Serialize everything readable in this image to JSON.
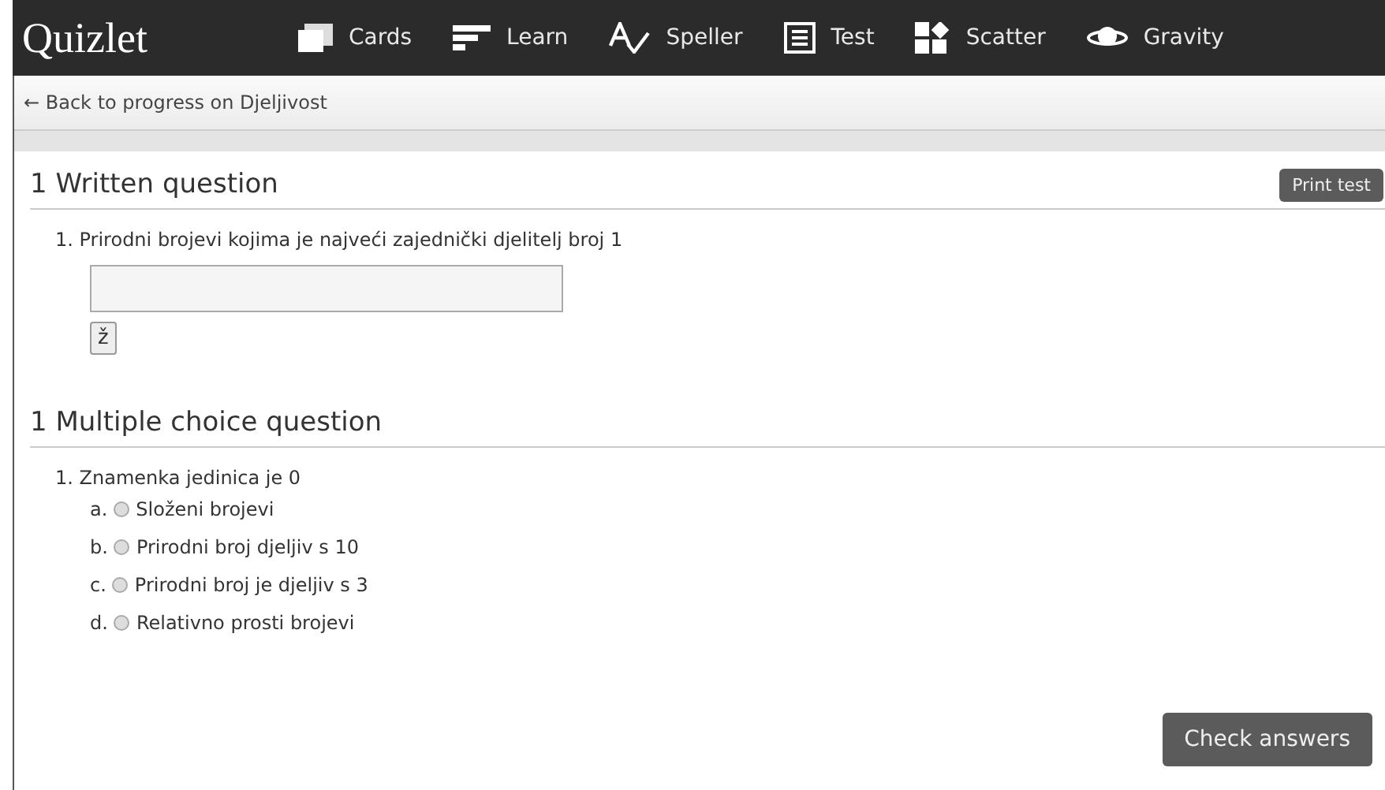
{
  "header": {
    "logo": "Quizlet",
    "nav": [
      {
        "kind": "cards",
        "label": "Cards"
      },
      {
        "kind": "learn",
        "label": "Learn"
      },
      {
        "kind": "speller",
        "label": "Speller"
      },
      {
        "kind": "test",
        "label": "Test"
      },
      {
        "kind": "scatter",
        "label": "Scatter"
      },
      {
        "kind": "gravity",
        "label": "Gravity"
      }
    ]
  },
  "back_link": "← Back to progress on Djeljivost",
  "print_button": "Print test",
  "written_section": {
    "title": "1 Written question",
    "questions": [
      {
        "number": "1.",
        "prompt": "Prirodni brojevi kojima je najveći zajednički djelitelj broj 1",
        "char_button": "ž"
      }
    ]
  },
  "multiple_choice_section": {
    "title": "1 Multiple choice question",
    "questions": [
      {
        "number": "1.",
        "prompt": "Znamenka jedinica je 0",
        "options": [
          {
            "letter": "a.",
            "text": "Složeni brojevi",
            "selected": false
          },
          {
            "letter": "b.",
            "text": "Prirodni broj djeljiv s 10",
            "selected": false
          },
          {
            "letter": "c.",
            "text": "Prirodni broj je djeljiv s 3",
            "selected": false
          },
          {
            "letter": "d.",
            "text": "Relativno prosti brojevi",
            "selected": false
          }
        ]
      }
    ]
  },
  "check_button": "Check answers"
}
